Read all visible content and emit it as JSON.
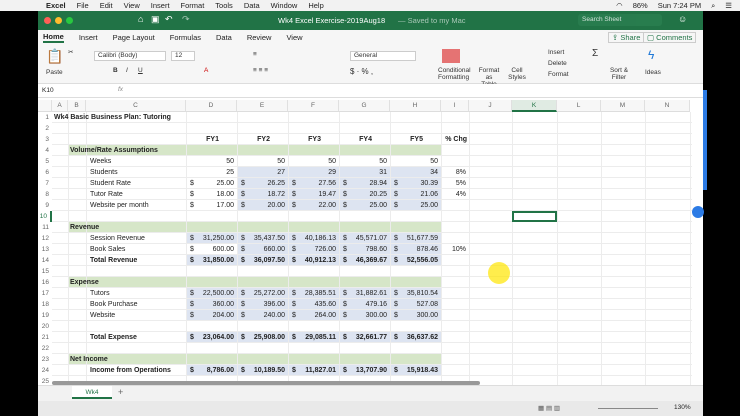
{
  "menubar": {
    "items": [
      "Excel",
      "File",
      "Edit",
      "View",
      "Insert",
      "Format",
      "Tools",
      "Data",
      "Window",
      "Help"
    ],
    "battery": "86%",
    "clock": "Sun 7:24 PM"
  },
  "titlebar": {
    "title": "Wk4 Excel Exercise-2019Aug18",
    "saved": "— Saved to my Mac",
    "search_placeholder": "Search Sheet"
  },
  "ribbon_tabs": [
    "Home",
    "Insert",
    "Page Layout",
    "Formulas",
    "Data",
    "Review",
    "View"
  ],
  "share": "Share",
  "comments": "Comments",
  "ribbon": {
    "paste": "Paste",
    "font": "Calibri (Body)",
    "size": "12",
    "number_format": "General",
    "cond": "Conditional Formatting",
    "table": "Format as Table",
    "styles": "Cell Styles",
    "insert": "Insert",
    "delete": "Delete",
    "format": "Format",
    "sort": "Sort & Filter",
    "ideas": "Ideas"
  },
  "formula_bar": {
    "name_box": "K10",
    "fx": "fx",
    "value": ""
  },
  "columns": [
    "A",
    "B",
    "C",
    "D",
    "E",
    "F",
    "G",
    "H",
    "I",
    "J",
    "K",
    "L",
    "M",
    "N"
  ],
  "selected_cell": "K10",
  "colors": {
    "accent": "#217346",
    "section_fill": "#d6e6c8",
    "input_fill": "#dde4f1"
  },
  "sheet": {
    "title": "Wk4 Basic Business Plan: Tutoring",
    "headers": [
      "FY1",
      "FY2",
      "FY3",
      "FY4",
      "FY5",
      "% Chg"
    ],
    "rows": [
      {
        "r": 4,
        "section": "Volume/Rate Assumptions"
      },
      {
        "r": 5,
        "label": "Weeks",
        "vals": [
          "50",
          "50",
          "50",
          "50",
          "50"
        ]
      },
      {
        "r": 6,
        "label": "Students",
        "vals": [
          "25",
          "27",
          "29",
          "31",
          "34"
        ],
        "chg": "8%"
      },
      {
        "r": 7,
        "label": "Student Rate",
        "cur": true,
        "vals": [
          "25.00",
          "26.25",
          "27.56",
          "28.94",
          "30.39"
        ],
        "chg": "5%"
      },
      {
        "r": 8,
        "label": "Tutor Rate",
        "cur": true,
        "vals": [
          "18.00",
          "18.72",
          "19.47",
          "20.25",
          "21.06"
        ],
        "chg": "4%"
      },
      {
        "r": 9,
        "label": "Website per month",
        "cur": true,
        "vals": [
          "17.00",
          "20.00",
          "22.00",
          "25.00",
          "25.00"
        ]
      },
      {
        "r": 11,
        "section": "Revenue"
      },
      {
        "r": 12,
        "label": "Session Revenue",
        "cur": true,
        "vals": [
          "31,250.00",
          "35,437.50",
          "40,186.13",
          "45,571.07",
          "51,677.59"
        ]
      },
      {
        "r": 13,
        "label": "Book Sales",
        "cur": true,
        "vals": [
          "600.00",
          "660.00",
          "726.00",
          "798.60",
          "878.46"
        ],
        "chg": "10%"
      },
      {
        "r": 14,
        "label": "Total Revenue",
        "cur": true,
        "bold": true,
        "vals": [
          "31,850.00",
          "36,097.50",
          "40,912.13",
          "46,369.67",
          "52,556.05"
        ]
      },
      {
        "r": 16,
        "section": "Expense"
      },
      {
        "r": 17,
        "label": "Tutors",
        "cur": true,
        "vals": [
          "22,500.00",
          "25,272.00",
          "28,385.51",
          "31,882.61",
          "35,810.54"
        ]
      },
      {
        "r": 18,
        "label": "Book Purchase",
        "cur": true,
        "vals": [
          "360.00",
          "396.00",
          "435.60",
          "479.16",
          "527.08"
        ]
      },
      {
        "r": 19,
        "label": "Website",
        "cur": true,
        "vals": [
          "204.00",
          "240.00",
          "264.00",
          "300.00",
          "300.00"
        ]
      },
      {
        "r": 21,
        "label": "Total Expense",
        "cur": true,
        "bold": true,
        "vals": [
          "23,064.00",
          "25,908.00",
          "29,085.11",
          "32,661.77",
          "36,637.62"
        ]
      },
      {
        "r": 23,
        "section": "Net Income"
      },
      {
        "r": 24,
        "label": "Income from Operations",
        "cur": true,
        "bold": true,
        "vals": [
          "8,786.00",
          "10,189.50",
          "11,827.01",
          "13,707.90",
          "15,918.43"
        ]
      }
    ]
  },
  "sheet_tabs": [
    "Wk4"
  ],
  "add_sheet": "+",
  "zoom_level": "130%"
}
